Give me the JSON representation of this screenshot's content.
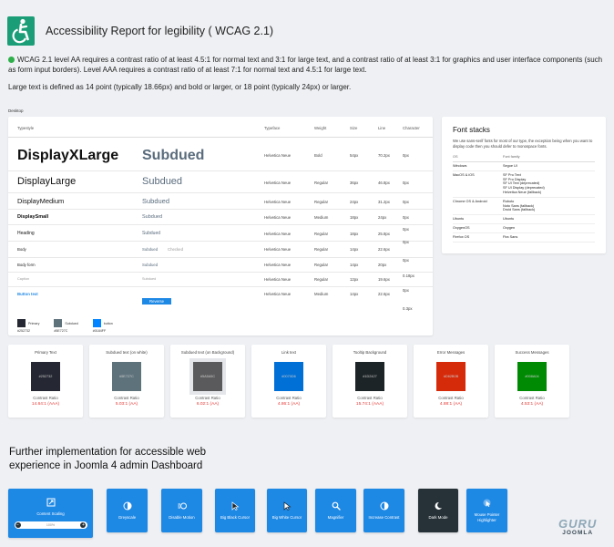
{
  "header": {
    "title": "Accessibility Report for legibility ( WCAG 2.1)"
  },
  "intro": {
    "paragraph1": "WCAG 2.1 level AA requires a contrast ratio of at least 4.5:1 for normal text and 3:1 for large text, and a contrast ratio of at least 3:1 for graphics and user interface components (such as form input borders). Level AAA requires a contrast ratio of at least 7:1 for normal text and 4.5:1 for large text.",
    "paragraph2": "Large text is defined as 14 point (typically 18.66px) and bold or larger, or 18 point (typically 24px) or larger."
  },
  "desktop_label": "Desktop",
  "type_table": {
    "headers": {
      "typestyle": "Typestyle",
      "typeface": "Typeface",
      "weight": "Weight",
      "size": "Size",
      "line": "Line",
      "character": "Character"
    },
    "rows": [
      {
        "label": "DisplayXLarge",
        "sample": "Subdued",
        "typeface": "Helvetica Neue",
        "weight": "Bold",
        "size": "54px",
        "line": "70.2px",
        "char": "0px"
      },
      {
        "label": "DisplayLarge",
        "sample": "Subdued",
        "typeface": "Helvetica Neue",
        "weight": "Regular",
        "size": "36px",
        "line": "46.8px",
        "char": "0px"
      },
      {
        "label": "DisplayMedium",
        "sample": "Subdued",
        "typeface": "Helvetica Neue",
        "weight": "Regular",
        "size": "24px",
        "line": "31.2px",
        "char": "0px"
      },
      {
        "label": "DisplaySmall",
        "sample": "Subdued",
        "typeface": "Helvetica Neue",
        "weight": "Medium",
        "size": "18px",
        "line": "24px",
        "char": "0px"
      },
      {
        "label": "Heading",
        "sample": "Subdued",
        "typeface": "Helvetica Neue",
        "weight": "Regular",
        "size": "18px",
        "line": "25.8px",
        "char": "0px"
      },
      {
        "label": "Body",
        "sample": "Subdued",
        "extra": "Checked",
        "typeface": "Helvetica Neue",
        "weight": "Regular",
        "size": "14px",
        "line": "22.6px",
        "char": "0px"
      },
      {
        "label": "Body form",
        "sample": "Subdued",
        "typeface": "Helvetica Neue",
        "weight": "Regular",
        "size": "14px",
        "line": "20px",
        "char": "0px"
      },
      {
        "label": "Caption",
        "sample": "Subdued",
        "typeface": "Helvetica Neue",
        "weight": "Regular",
        "size": "12px",
        "line": "19.6px",
        "char": "0.18px"
      },
      {
        "label": "Button text",
        "sample": "Reverse",
        "typeface": "Helvetica Neue",
        "weight": "Medium",
        "size": "14px",
        "line": "22.6px",
        "char": "0px"
      }
    ],
    "last_char_value": "0.3px",
    "swatches": [
      {
        "name": "Primary",
        "hex": "#252732",
        "color": "#252732"
      },
      {
        "name": "Subdued",
        "hex": "#5E727C",
        "color": "#5E727C"
      },
      {
        "name": "button",
        "hex": "#0184FF",
        "color": "#0184FF"
      }
    ]
  },
  "font_stacks": {
    "title": "Font stacks",
    "description": "We use sans-serif fonts for most of our type, the exception being when you want to display code then you should defer to monospace fonts.",
    "headers": {
      "os": "OS",
      "family": "Font family"
    },
    "rows": [
      {
        "os": "Windows",
        "family": "Segoe UI"
      },
      {
        "os": "MacOS & iOS",
        "family": "SF Pro Text\nSF Pro Display\nSF UI Text (deprecated)\nSF UI Display (deprecated)\nHelvetica Neue (fallback)"
      },
      {
        "os": "Chrome OS & Android",
        "family": "Roboto\nNoto Sans (fallback)\nDroid Sans (fallback)"
      },
      {
        "os": "Ubuntu",
        "family": "Ubuntu"
      },
      {
        "os": "OxygenOS",
        "family": "Oxygen"
      },
      {
        "os": "Firefox OS",
        "family": "Fira Sans"
      }
    ]
  },
  "contrast": {
    "ratio_label": "Contrast Ratio",
    "cards": [
      {
        "title": "Primary Text",
        "hex": "#252732",
        "color": "#252732",
        "ratio": "14.64:1 (AAA)"
      },
      {
        "title": "Subdued text (on white)",
        "hex": "#5E727C",
        "color": "#5E727C",
        "ratio": "5.03:1 (AA)"
      },
      {
        "title": "Subdued text (on Background)",
        "hex": "#5A5A5C",
        "color": "#5A5A5C",
        "ratio": "6.02:1 (AA)"
      },
      {
        "title": "Link text",
        "hex": "#0070D6",
        "color": "#0070D6",
        "ratio": "4.86:1 (AA)"
      },
      {
        "title": "Tooltip Background",
        "hex": "#1D2427",
        "color": "#1D2427",
        "ratio": "15.74:1 (AAA)"
      },
      {
        "title": "Error Messages",
        "hex": "#D62B0B",
        "color": "#D62B0B",
        "ratio": "4.88:1 (AA)"
      },
      {
        "title": "Success Messages",
        "hex": "#008A04",
        "color": "#008A04",
        "ratio": "4.53:1 (AA)"
      }
    ]
  },
  "further": {
    "text": "Further implementation for accessible web experience in Joomla 4 admin Dashboard"
  },
  "tools": {
    "content_scaling": "Content Scaling",
    "scaling_value": "100%",
    "greyscale": "Greyscale",
    "disable_motion": "Disable Motion",
    "big_black_cursor": "Big Black Cursor",
    "big_white_cursor": "Big White Cursor",
    "magnifier": "Magnifier",
    "increase_contrast": "Increase Contrast",
    "dark_mode": "Dark Mode",
    "mouse_pointer_highlighter": "Mouse Pointer Highlighter"
  },
  "brand": {
    "line1": "GURU",
    "line2": "JOOMLA"
  },
  "colors": {
    "accent": "#1E88E5",
    "check": "#2EAF4A",
    "error": "#E53935",
    "logo": "#1B9E77"
  }
}
